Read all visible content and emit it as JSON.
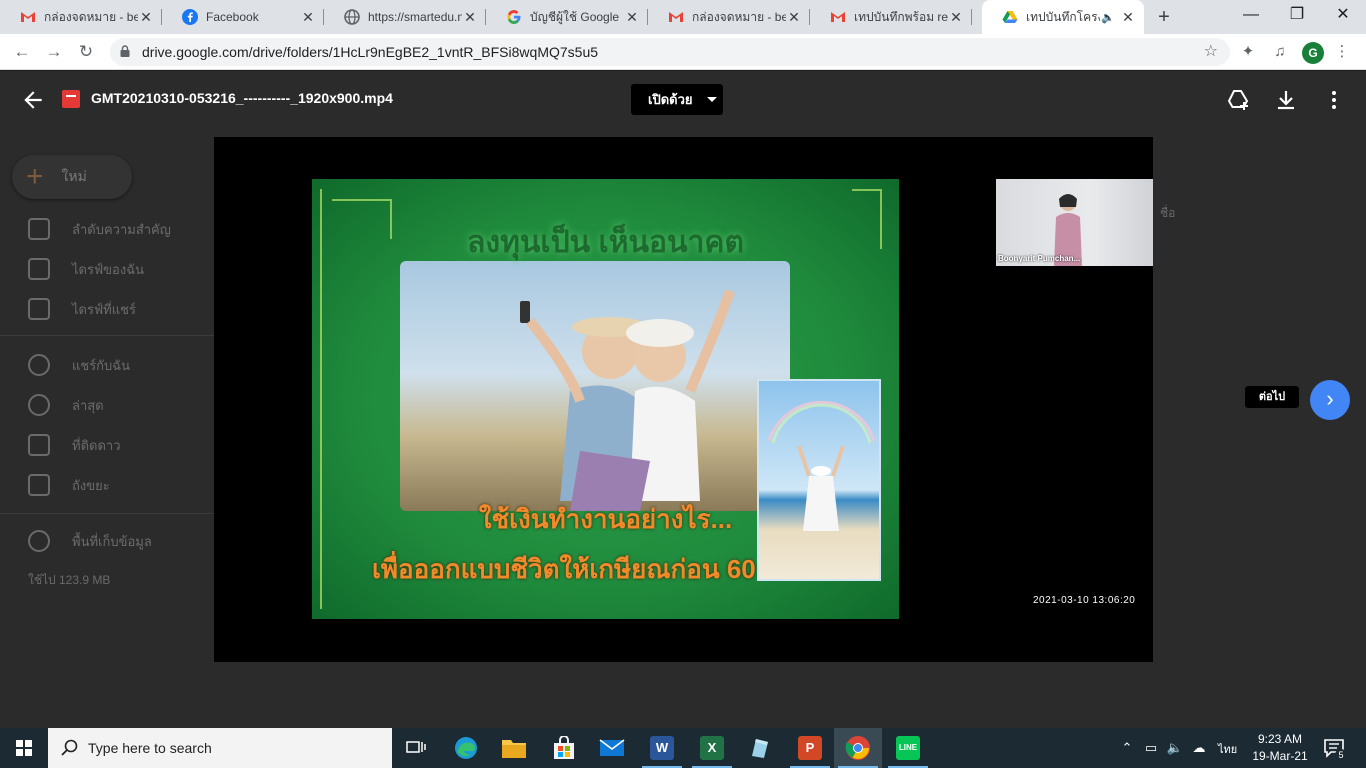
{
  "browser": {
    "tabs": [
      {
        "title": "กล่องจดหมาย - benj",
        "icon": "gmail-icon",
        "close": "✕"
      },
      {
        "title": "Facebook",
        "icon": "facebook-icon",
        "close": "✕"
      },
      {
        "title": "https://smartedu.n",
        "icon": "globe-icon",
        "close": "✕"
      },
      {
        "title": "บัญชีผู้ใช้ Google",
        "icon": "google-icon",
        "close": "✕"
      },
      {
        "title": "กล่องจดหมาย - benj",
        "icon": "gmail-icon",
        "close": "✕"
      },
      {
        "title": "เทปบันทึกพร้อม repo",
        "icon": "gmail-icon",
        "close": "✕"
      },
      {
        "title": "เทปบันทึกโครงก",
        "icon": "google-drive-icon",
        "close": "✕",
        "active": true
      }
    ],
    "new_tab": "+",
    "window_controls": {
      "minimize": "—",
      "restore": "❐",
      "close": "✕"
    },
    "url": "drive.google.com/drive/folders/1HcLr9nEgBE2_1vntR_BFSi8wqMQ7s5u5",
    "profile_initial": "G"
  },
  "drive": {
    "new_label": "ใหม่",
    "sidebar": [
      {
        "label": "ลำดับความสำคัญ"
      },
      {
        "label": "ไดรฟ์ของฉัน"
      },
      {
        "label": "ไดรฟ์ที่แชร์"
      },
      {
        "label": "แชร์กับฉัน"
      },
      {
        "label": "ล่าสุด"
      },
      {
        "label": "ที่ติดดาว"
      },
      {
        "label": "ถังขยะ"
      },
      {
        "label": "พื้นที่เก็บข้อมูล"
      }
    ],
    "storage_used": "ใช้ไป 123.9 MB",
    "sort_label": "ชื่อ"
  },
  "viewer": {
    "file_name": "GMT20210310-053216_----------_1920x900.mp4",
    "open_with": "เปิดด้วย",
    "next_tooltip": "ต่อไป"
  },
  "video": {
    "slide_title": "ลงทุนเป็น เห็นอนาคต",
    "slide_line1": "ใช้เงินทำงานอย่างไร...",
    "slide_line2": "เพื่อออกแบบชีวิตให้เกษียณก่อน 60",
    "webcam_label": "Boonyarit Pumchan...",
    "timestamp": "2021-03-10 13:06:20"
  },
  "taskbar": {
    "search_placeholder": "Type here to search",
    "language": "ไทย",
    "time": "9:23 AM",
    "date": "19-Mar-21",
    "notification_count": "5"
  }
}
